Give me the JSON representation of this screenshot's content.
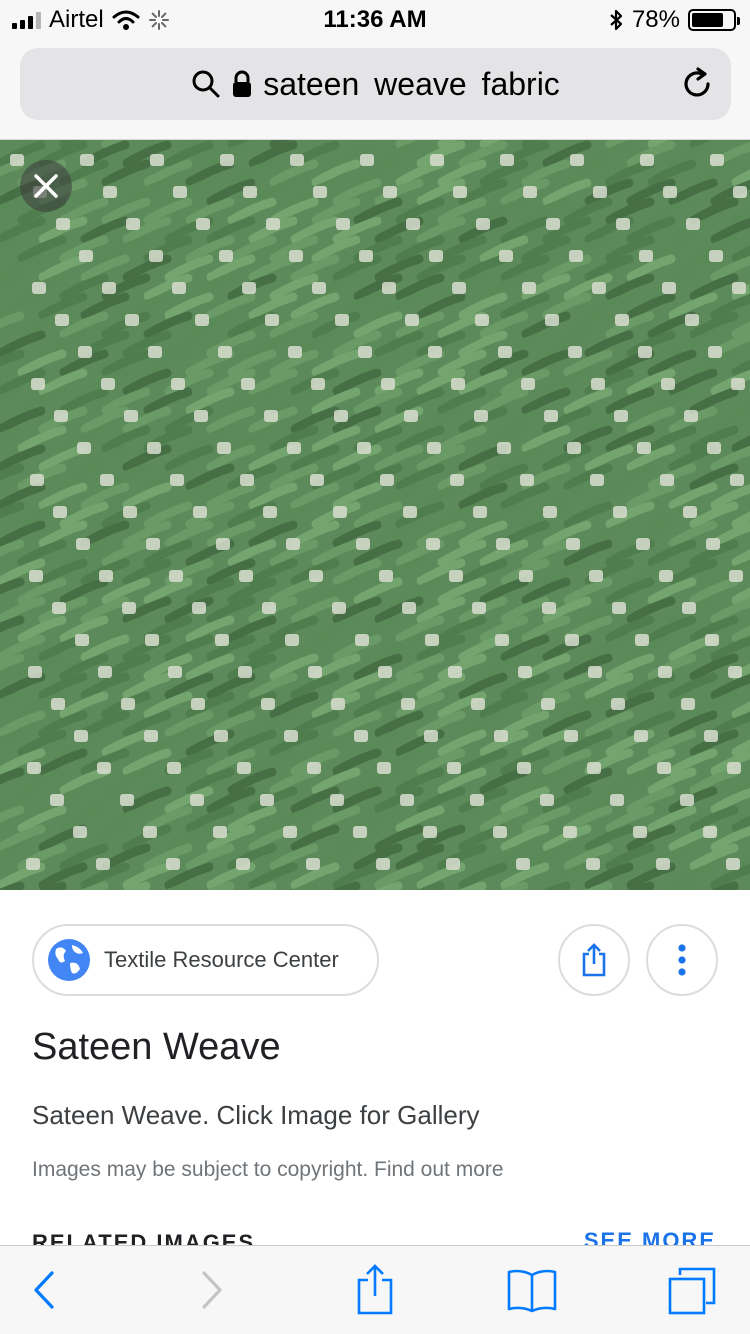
{
  "status_bar": {
    "carrier": "Airtel",
    "time": "11:36 AM",
    "battery_percent": "78%",
    "battery_level": 0.78
  },
  "browser": {
    "url_text": "sateen  weave fabric"
  },
  "image": {
    "close_icon": "close-icon",
    "fabric_color": "#5c8a5a"
  },
  "info": {
    "source_name": "Textile Resource Center",
    "title": "Sateen Weave",
    "description": "Sateen Weave. Click Image for Gallery",
    "copyright_note": "Images may be subject to copyright. Find out more",
    "related_heading": "RELATED IMAGES",
    "see_more": "SEE MORE"
  },
  "colors": {
    "accent": "#1a73e8",
    "ios_blue": "#007aff"
  }
}
